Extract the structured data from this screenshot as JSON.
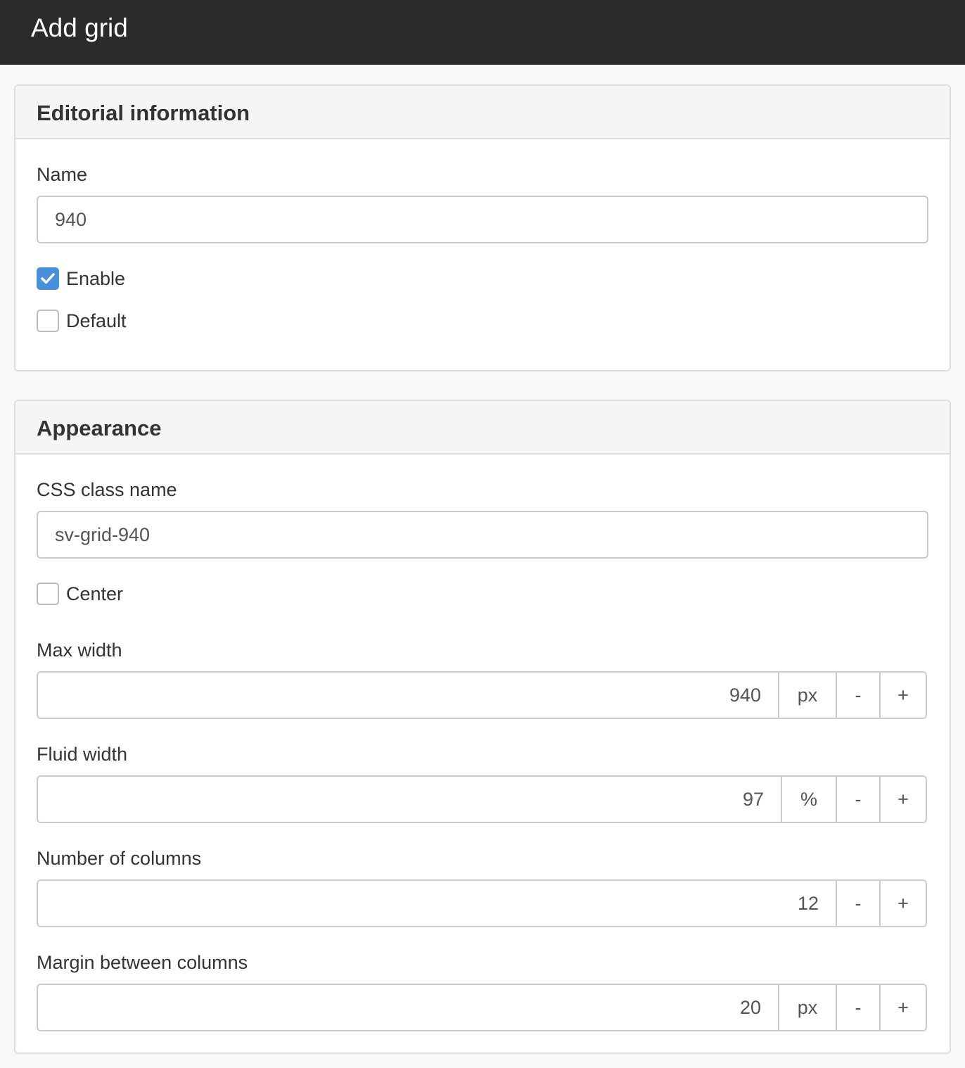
{
  "header": {
    "title": "Add grid"
  },
  "editorial": {
    "heading": "Editorial information",
    "name_label": "Name",
    "name_value": "940",
    "enable_label": "Enable",
    "enable_checked": true,
    "default_label": "Default",
    "default_checked": false
  },
  "appearance": {
    "heading": "Appearance",
    "css_label": "CSS class name",
    "css_value": "sv-grid-940",
    "center_label": "Center",
    "center_checked": false,
    "max_width": {
      "label": "Max width",
      "value": "940",
      "unit": "px",
      "minus": "-",
      "plus": "+"
    },
    "fluid_width": {
      "label": "Fluid width",
      "value": "97",
      "unit": "%",
      "minus": "-",
      "plus": "+"
    },
    "columns": {
      "label": "Number of columns",
      "value": "12",
      "minus": "-",
      "plus": "+"
    },
    "margin": {
      "label": "Margin between columns",
      "value": "20",
      "unit": "px",
      "minus": "-",
      "plus": "+"
    }
  },
  "colors": {
    "topbar": "#2b2b2b",
    "checkbox_checked": "#4a90d9",
    "panel_heading_bg": "#f5f5f5",
    "border": "#dddddd"
  }
}
